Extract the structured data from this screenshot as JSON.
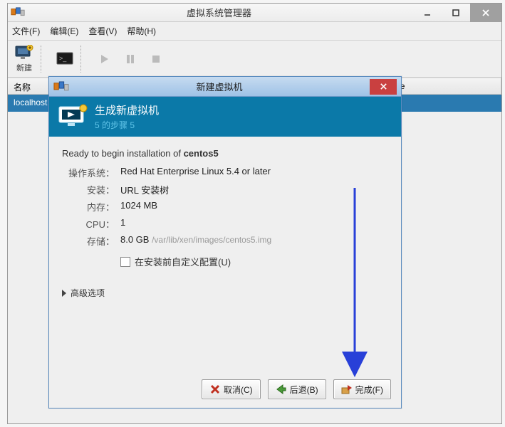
{
  "main": {
    "title": "虚拟系统管理器",
    "menu": {
      "file": "文件(F)",
      "edit": "编辑(E)",
      "view": "查看(V)",
      "help": "帮助(H)"
    },
    "toolbar": {
      "new": "新建"
    },
    "columns": {
      "name": "名称",
      "cpu": "Host CPU usage"
    },
    "row0": "localhost"
  },
  "dialog": {
    "title": "新建虚拟机",
    "header": {
      "line1": "生成新虚拟机",
      "line2": "5 的步骤 5"
    },
    "ready_prefix": "Ready to begin installation of ",
    "ready_name": "centos5",
    "specs": {
      "os_label": "操作系统：",
      "os_value": "Red Hat Enterprise Linux 5.4 or later",
      "install_label": "安装：",
      "install_value": "URL 安装树",
      "mem_label": "内存：",
      "mem_value": "1024 MB",
      "cpu_label": "CPU：",
      "cpu_value": "1",
      "storage_label": "存储：",
      "storage_value": "8.0 GB",
      "storage_path": "/var/lib/xen/images/centos5.img"
    },
    "customize": "在安装前自定义配置(U)",
    "advanced": "高级选项",
    "buttons": {
      "cancel": "取消(C)",
      "back": "后退(B)",
      "finish": "完成(F)"
    }
  }
}
